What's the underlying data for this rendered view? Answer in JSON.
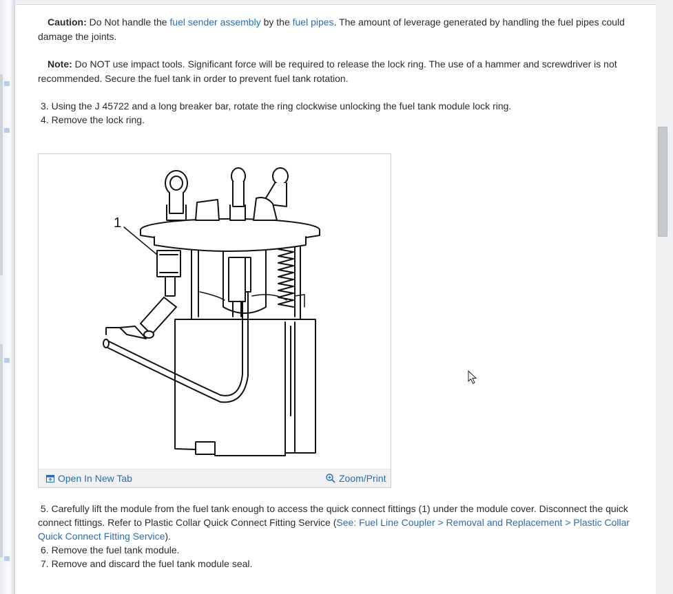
{
  "caution": {
    "label": "Caution:",
    "text_1": " Do Not handle the ",
    "link_1": "fuel sender assembly",
    "text_2": " by the ",
    "link_2": "fuel pipes",
    "text_3": ". The amount of leverage generated by handling the fuel pipes could damage the joints."
  },
  "note": {
    "label": "Note:",
    "text": " Do NOT use impact tools. Significant force will be required to release the lock ring. The use of a hammer and screwdriver is not recommended. Secure the fuel tank in order to prevent fuel tank rotation."
  },
  "steps_before": [
    {
      "number": "3.",
      "text": "Using the J 45722 and a long breaker bar, rotate the ring clockwise unlocking the fuel tank module lock ring."
    },
    {
      "number": "4.",
      "text": "Remove the lock ring."
    }
  ],
  "figure": {
    "callout": "1",
    "open_new_tab": "Open In New Tab",
    "zoom_print": "Zoom/Print"
  },
  "step_5": {
    "number": "5.",
    "text_1": "Carefully lift the module from the fuel tank enough to access the quick connect fittings (1) under the module cover. Disconnect the quick connect fittings. Refer to Plastic Collar Quick Connect Fitting Service (",
    "link": "See: Fuel Line Coupler > Removal and Replacement > Plastic Collar Quick Connect Fitting Service",
    "text_2": ")."
  },
  "steps_after": [
    {
      "number": "6.",
      "text": "Remove the fuel tank module."
    },
    {
      "number": "7.",
      "text": "Remove and discard the fuel tank module seal."
    }
  ],
  "colors": {
    "link": "#2a6db5",
    "text": "#2b2b2b",
    "figure_footer": "#f0f1f3"
  }
}
